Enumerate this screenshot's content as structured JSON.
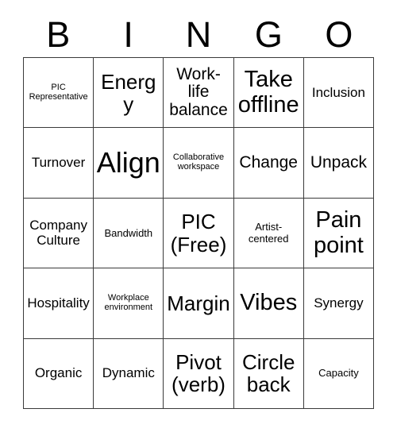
{
  "card": {
    "header_letters": [
      "B",
      "I",
      "N",
      "G",
      "O"
    ],
    "columns": [
      "B",
      "I",
      "N",
      "G",
      "O"
    ],
    "free_space_label": "PIC (Free)",
    "border_color": "#3a3a3a",
    "background_color": "#ffffff",
    "text_color": "#000000",
    "rows": [
      [
        {
          "label": "PIC Representative",
          "size": "xxs"
        },
        {
          "label": "Energy",
          "size": "lg"
        },
        {
          "label": "Work-life balance",
          "size": "md"
        },
        {
          "label": "Take offline",
          "size": "xl"
        },
        {
          "label": "Inclusion",
          "size": "sm"
        }
      ],
      [
        {
          "label": "Turnover",
          "size": "sm"
        },
        {
          "label": "Align",
          "size": "xxl"
        },
        {
          "label": "Collaborative workspace",
          "size": "xxs"
        },
        {
          "label": "Change",
          "size": "md"
        },
        {
          "label": "Unpack",
          "size": "md"
        }
      ],
      [
        {
          "label": "Company Culture",
          "size": "sm"
        },
        {
          "label": "Bandwidth",
          "size": "xs"
        },
        {
          "label": "PIC (Free)",
          "size": "lg"
        },
        {
          "label": "Artist-centered",
          "size": "xs"
        },
        {
          "label": "Pain point",
          "size": "xl"
        }
      ],
      [
        {
          "label": "Hospitality",
          "size": "sm"
        },
        {
          "label": "Workplace environment",
          "size": "xxs"
        },
        {
          "label": "Margin",
          "size": "lg"
        },
        {
          "label": "Vibes",
          "size": "xl"
        },
        {
          "label": "Synergy",
          "size": "sm"
        }
      ],
      [
        {
          "label": "Organic",
          "size": "sm"
        },
        {
          "label": "Dynamic",
          "size": "sm"
        },
        {
          "label": "Pivot (verb)",
          "size": "lg"
        },
        {
          "label": "Circle back",
          "size": "lg"
        },
        {
          "label": "Capacity",
          "size": "xs"
        }
      ]
    ]
  }
}
